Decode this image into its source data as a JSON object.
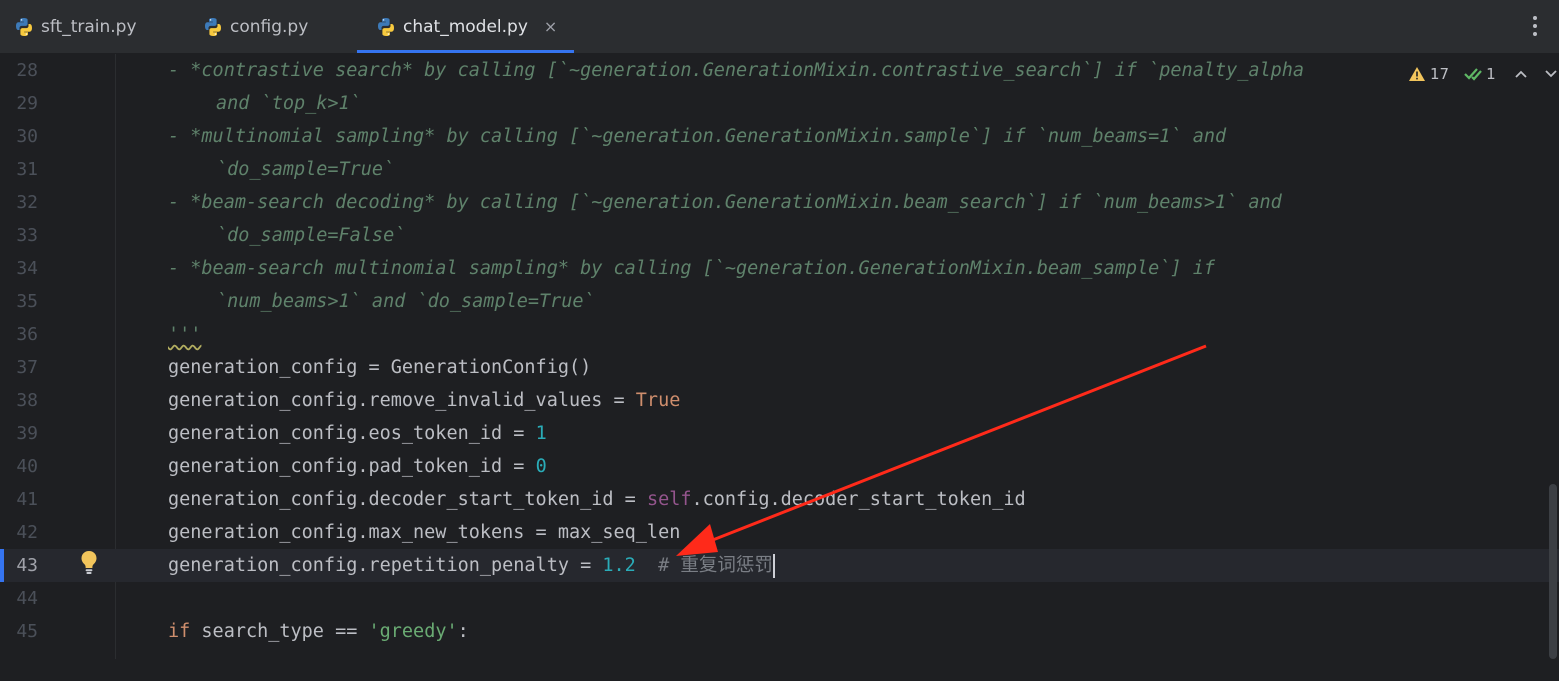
{
  "tabs": [
    {
      "label": "sft_train.py",
      "active": false
    },
    {
      "label": "config.py",
      "active": false
    },
    {
      "label": "chat_model.py",
      "active": true
    }
  ],
  "tab_close_glyph": "×",
  "inspection": {
    "warnings": "17",
    "checks": "1"
  },
  "editor": {
    "current_line": "43",
    "lines": [
      {
        "n": "28",
        "parts": [
          "- *contrastive search* by calling [`~generation.GenerationMixin.contrastive_search`] if `penalty_alpha"
        ]
      },
      {
        "n": "29",
        "parts": [
          "and `top_k>1`"
        ]
      },
      {
        "n": "30",
        "parts": [
          "- *multinomial sampling* by calling [`~generation.GenerationMixin.sample`] if `num_beams=1` and"
        ]
      },
      {
        "n": "31",
        "parts": [
          "`do_sample=True`"
        ]
      },
      {
        "n": "32",
        "parts": [
          "- *beam-search decoding* by calling [`~generation.GenerationMixin.beam_search`] if `num_beams>1` and"
        ]
      },
      {
        "n": "33",
        "parts": [
          "`do_sample=False`"
        ]
      },
      {
        "n": "34",
        "parts": [
          "- *beam-search multinomial sampling* by calling [`~generation.GenerationMixin.beam_sample`] if"
        ]
      },
      {
        "n": "35",
        "parts": [
          "`num_beams>1` and `do_sample=True`"
        ]
      },
      {
        "n": "36",
        "parts": [
          "'''"
        ]
      },
      {
        "n": "37",
        "parts": [
          "generation_config = GenerationConfig()"
        ]
      },
      {
        "n": "38",
        "parts": [
          "generation_config.remove_invalid_values = ",
          "True"
        ]
      },
      {
        "n": "39",
        "parts": [
          "generation_config.eos_token_id = ",
          "1"
        ]
      },
      {
        "n": "40",
        "parts": [
          "generation_config.pad_token_id = ",
          "0"
        ]
      },
      {
        "n": "41",
        "parts": [
          "generation_config.decoder_start_token_id = ",
          "self",
          ".config.decoder_start_token_id"
        ]
      },
      {
        "n": "42",
        "parts": [
          "generation_config.max_new_tokens = max_seq_len"
        ]
      },
      {
        "n": "43",
        "parts": [
          "generation_config.repetition_penalty = ",
          "1.2",
          "  # 重复词惩罚"
        ]
      },
      {
        "n": "44",
        "parts": [
          ""
        ]
      },
      {
        "n": "45",
        "parts": [
          "if",
          " search_type == ",
          "'greedy'",
          ":"
        ]
      }
    ]
  },
  "colors": {
    "background": "#1e1f22",
    "tabbar": "#2b2d30",
    "accent": "#3574f0",
    "docstring": "#5f826b",
    "keyword": "#cf8e6d",
    "number": "#2aacb8",
    "annotation_arrow": "#ff2a1a"
  },
  "icons": {
    "tab_icon": "python-icon",
    "warning": "warning-triangle-icon",
    "check": "double-check-icon",
    "nav_up": "chevron-up-icon",
    "nav_down": "chevron-down-icon",
    "more": "more-vertical-icon",
    "intention": "lightbulb-icon"
  }
}
